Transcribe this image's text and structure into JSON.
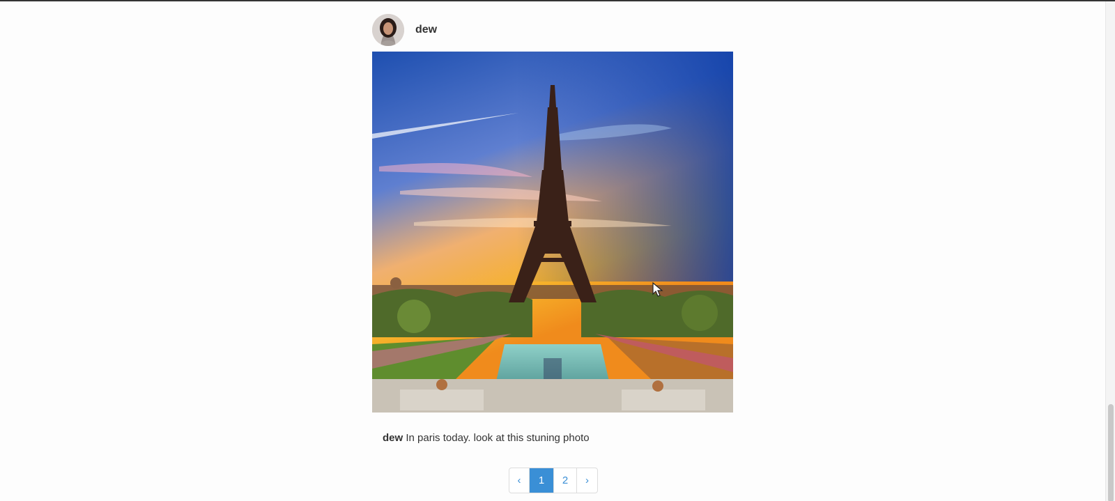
{
  "post": {
    "username": "dew",
    "caption_user": "dew",
    "caption_text": "In paris today. look at this stuning photo"
  },
  "pagination": {
    "prev": "‹",
    "pages": [
      "1",
      "2"
    ],
    "next": "›",
    "active_page": "1"
  },
  "colors": {
    "accent": "#3a8fd6",
    "text": "#333333",
    "background": "#fdfdfd"
  }
}
